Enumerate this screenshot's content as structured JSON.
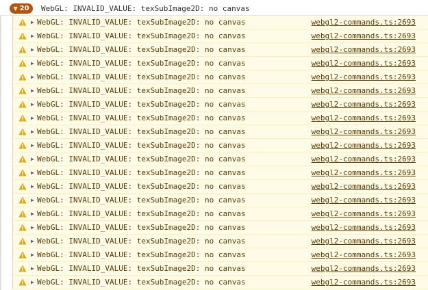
{
  "group": {
    "count": "20",
    "message": "WebGL: INVALID_VALUE: texSubImage2D: no canvas",
    "color": "#b45309"
  },
  "warning_icon": "warning-triangle-icon",
  "rows": [
    {
      "message": "WebGL: INVALID_VALUE: texSubImage2D: no canvas",
      "source": "webgl2-commands.ts:2693"
    },
    {
      "message": "WebGL: INVALID_VALUE: texSubImage2D: no canvas",
      "source": "webgl2-commands.ts:2693"
    },
    {
      "message": "WebGL: INVALID_VALUE: texSubImage2D: no canvas",
      "source": "webgl2-commands.ts:2693"
    },
    {
      "message": "WebGL: INVALID_VALUE: texSubImage2D: no canvas",
      "source": "webgl2-commands.ts:2693"
    },
    {
      "message": "WebGL: INVALID_VALUE: texSubImage2D: no canvas",
      "source": "webgl2-commands.ts:2693"
    },
    {
      "message": "WebGL: INVALID_VALUE: texSubImage2D: no canvas",
      "source": "webgl2-commands.ts:2693"
    },
    {
      "message": "WebGL: INVALID_VALUE: texSubImage2D: no canvas",
      "source": "webgl2-commands.ts:2693"
    },
    {
      "message": "WebGL: INVALID_VALUE: texSubImage2D: no canvas",
      "source": "webgl2-commands.ts:2693"
    },
    {
      "message": "WebGL: INVALID_VALUE: texSubImage2D: no canvas",
      "source": "webgl2-commands.ts:2693"
    },
    {
      "message": "WebGL: INVALID_VALUE: texSubImage2D: no canvas",
      "source": "webgl2-commands.ts:2693"
    },
    {
      "message": "WebGL: INVALID_VALUE: texSubImage2D: no canvas",
      "source": "webgl2-commands.ts:2693"
    },
    {
      "message": "WebGL: INVALID_VALUE: texSubImage2D: no canvas",
      "source": "webgl2-commands.ts:2693"
    },
    {
      "message": "WebGL: INVALID_VALUE: texSubImage2D: no canvas",
      "source": "webgl2-commands.ts:2693"
    },
    {
      "message": "WebGL: INVALID_VALUE: texSubImage2D: no canvas",
      "source": "webgl2-commands.ts:2693"
    },
    {
      "message": "WebGL: INVALID_VALUE: texSubImage2D: no canvas",
      "source": "webgl2-commands.ts:2693"
    },
    {
      "message": "WebGL: INVALID_VALUE: texSubImage2D: no canvas",
      "source": "webgl2-commands.ts:2693"
    },
    {
      "message": "WebGL: INVALID_VALUE: texSubImage2D: no canvas",
      "source": "webgl2-commands.ts:2693"
    },
    {
      "message": "WebGL: INVALID_VALUE: texSubImage2D: no canvas",
      "source": "webgl2-commands.ts:2693"
    },
    {
      "message": "WebGL: INVALID_VALUE: texSubImage2D: no canvas",
      "source": "webgl2-commands.ts:2693"
    },
    {
      "message": "WebGL: INVALID_VALUE: texSubImage2D: no canvas",
      "source": "webgl2-commands.ts:2693"
    }
  ]
}
